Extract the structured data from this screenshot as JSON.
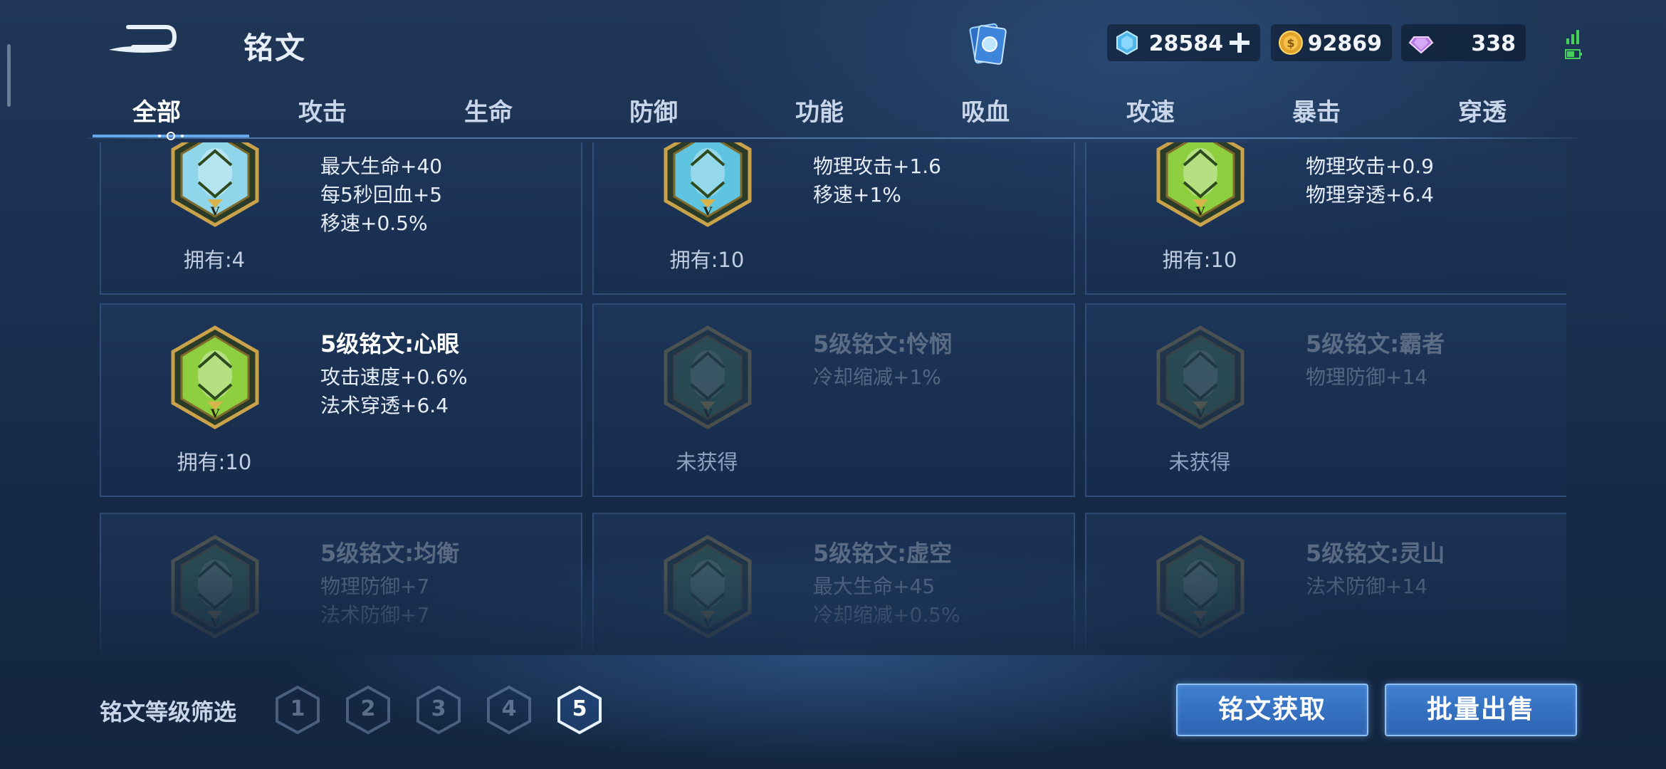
{
  "header": {
    "title": "铭文",
    "currencies": {
      "diamond": "28584",
      "gold": "92869",
      "gem": "338"
    }
  },
  "tabs": [
    {
      "label": "全部",
      "active": true
    },
    {
      "label": "攻击",
      "active": false
    },
    {
      "label": "生命",
      "active": false
    },
    {
      "label": "防御",
      "active": false
    },
    {
      "label": "功能",
      "active": false
    },
    {
      "label": "吸血",
      "active": false
    },
    {
      "label": "攻速",
      "active": false
    },
    {
      "label": "暴击",
      "active": false
    },
    {
      "label": "穿透",
      "active": false
    }
  ],
  "runes": [
    {
      "name": "",
      "attrs": [
        "最大生命+40",
        "每5秒回血+5",
        "移速+0.5%"
      ],
      "owned": "拥有:4",
      "acquired": true,
      "color": "#8fd6ea"
    },
    {
      "name": "",
      "attrs": [
        "物理攻击+1.6",
        "移速+1%"
      ],
      "owned": "拥有:10",
      "acquired": true,
      "color": "#5fc4e0"
    },
    {
      "name": "",
      "attrs": [
        "物理攻击+0.9",
        "物理穿透+6.4"
      ],
      "owned": "拥有:10",
      "acquired": true,
      "color": "#8dcf3f"
    },
    {
      "name": "5级铭文:心眼",
      "attrs": [
        "攻击速度+0.6%",
        "法术穿透+6.4"
      ],
      "owned": "拥有:10",
      "acquired": true,
      "color": "#8dcf3f"
    },
    {
      "name": "5级铭文:怜悯",
      "attrs": [
        "冷却缩减+1%"
      ],
      "owned": "未获得",
      "acquired": false,
      "color": "#4f8a55"
    },
    {
      "name": "5级铭文:霸者",
      "attrs": [
        "物理防御+14"
      ],
      "owned": "未获得",
      "acquired": false,
      "color": "#4f8a55"
    },
    {
      "name": "5级铭文:均衡",
      "attrs": [
        "物理防御+7",
        "法术防御+7"
      ],
      "owned": "",
      "acquired": false,
      "color": "#4f8a55"
    },
    {
      "name": "5级铭文:虚空",
      "attrs": [
        "最大生命+45",
        "冷却缩减+0.5%"
      ],
      "owned": "",
      "acquired": false,
      "color": "#4f8a55"
    },
    {
      "name": "5级铭文:灵山",
      "attrs": [
        "法术防御+14"
      ],
      "owned": "",
      "acquired": false,
      "color": "#4f8a55"
    }
  ],
  "filter": {
    "label": "铭文等级筛选",
    "levels": [
      "1",
      "2",
      "3",
      "4",
      "5"
    ],
    "selected": "5"
  },
  "actions": {
    "get_rune": "铭文获取",
    "bulk_sell": "批量出售"
  },
  "colors": {
    "accent": "#3f7fd0",
    "background": "#1a3050"
  }
}
